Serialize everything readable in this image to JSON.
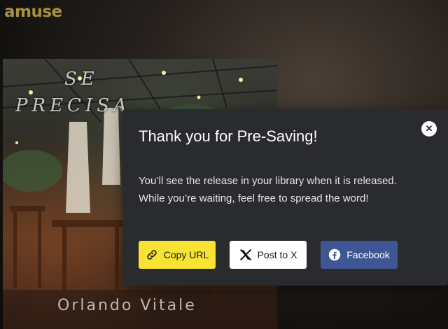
{
  "header": {
    "logo_text": "amuse"
  },
  "cover": {
    "title_text": [
      "SE",
      "PRECISA"
    ],
    "artist": "Orlando Vitale"
  },
  "modal": {
    "title": "Thank you for Pre-Saving!",
    "message_line1": "You’ll see the release in your library when it is released.",
    "message_line2": "While you’re waiting, feel free to spread the word!",
    "close_icon": "close-icon",
    "buttons": [
      {
        "label": "Copy URL",
        "icon": "link-icon",
        "color": "#f7e334"
      },
      {
        "label": "Post to X",
        "icon": "x-logo-icon",
        "color": "#ffffff"
      },
      {
        "label": "Facebook",
        "icon": "facebook-icon",
        "color": "#3e5794"
      }
    ]
  }
}
